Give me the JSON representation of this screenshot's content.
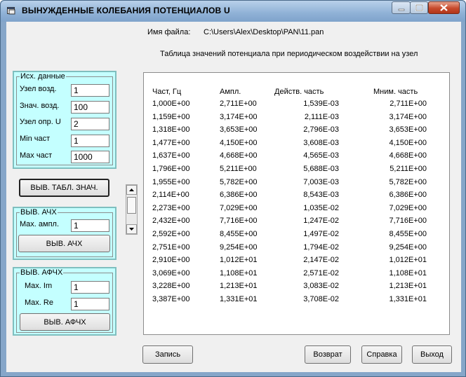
{
  "window": {
    "title": "ВЫНУЖДЕННЫЕ КОЛЕБАНИЯ ПОТЕНЦИАЛОВ   U",
    "file_label": "Имя файла:",
    "file_path": "C:\\Users\\Alex\\Desktop\\PAN\\11.pan",
    "table_caption": "Таблица значений  потенциала   при     периодическом  воздействии на узел"
  },
  "input_panel": {
    "legend": "Исх. данные",
    "fields": [
      {
        "label": "Узел возд.",
        "value": "1"
      },
      {
        "label": "Знач. возд.",
        "value": "100"
      },
      {
        "label": "Узел опр. U",
        "value": "2"
      },
      {
        "label": "Min част",
        "value": "1"
      },
      {
        "label": "Max част",
        "value": "1000"
      }
    ],
    "show_table_button": "ВЫВ. ТАБЛ. ЗНАЧ."
  },
  "afc_panel": {
    "legend": "ВЫВ. АЧХ",
    "field_label": "Max. ампл.",
    "field_value": "1",
    "button": "ВЫВ. АЧХ"
  },
  "afchx_panel": {
    "legend": "ВЫВ. АФЧХ",
    "fields": [
      {
        "label": "Max. Im",
        "value": "1"
      },
      {
        "label": "Max. Re",
        "value": "1"
      }
    ],
    "button": "ВЫВ. АФЧХ"
  },
  "table": {
    "headers": [
      "Част, Гц",
      "Ампл.",
      "Действ. часть",
      "Мним. часть"
    ],
    "rows": [
      [
        "1,000E+00",
        "2,711E+00",
        "1,539E-03",
        "2,711E+00"
      ],
      [
        "1,159E+00",
        "3,174E+00",
        "2,111E-03",
        "3,174E+00"
      ],
      [
        "1,318E+00",
        "3,653E+00",
        "2,796E-03",
        "3,653E+00"
      ],
      [
        "1,477E+00",
        "4,150E+00",
        "3,608E-03",
        "4,150E+00"
      ],
      [
        "1,637E+00",
        "4,668E+00",
        "4,565E-03",
        "4,668E+00"
      ],
      [
        "1,796E+00",
        "5,211E+00",
        "5,688E-03",
        "5,211E+00"
      ],
      [
        "1,955E+00",
        "5,782E+00",
        "7,003E-03",
        "5,782E+00"
      ],
      [
        "2,114E+00",
        "6,386E+00",
        "8,543E-03",
        "6,386E+00"
      ],
      [
        "2,273E+00",
        "7,029E+00",
        "1,035E-02",
        "7,029E+00"
      ],
      [
        "2,432E+00",
        "7,716E+00",
        "1,247E-02",
        "7,716E+00"
      ],
      [
        "2,592E+00",
        "8,455E+00",
        "1,497E-02",
        "8,455E+00"
      ],
      [
        "2,751E+00",
        "9,254E+00",
        "1,794E-02",
        "9,254E+00"
      ],
      [
        "2,910E+00",
        "1,012E+01",
        "2,147E-02",
        "1,012E+01"
      ],
      [
        "3,069E+00",
        "1,108E+01",
        "2,571E-02",
        "1,108E+01"
      ],
      [
        "3,228E+00",
        "1,213E+01",
        "3,083E-02",
        "1,213E+01"
      ],
      [
        "3,387E+00",
        "1,331E+01",
        "3,708E-02",
        "1,331E+01"
      ]
    ]
  },
  "bottom_buttons": {
    "save": "Запись",
    "back": "Возврат",
    "help": "Справка",
    "exit": "Выход"
  }
}
